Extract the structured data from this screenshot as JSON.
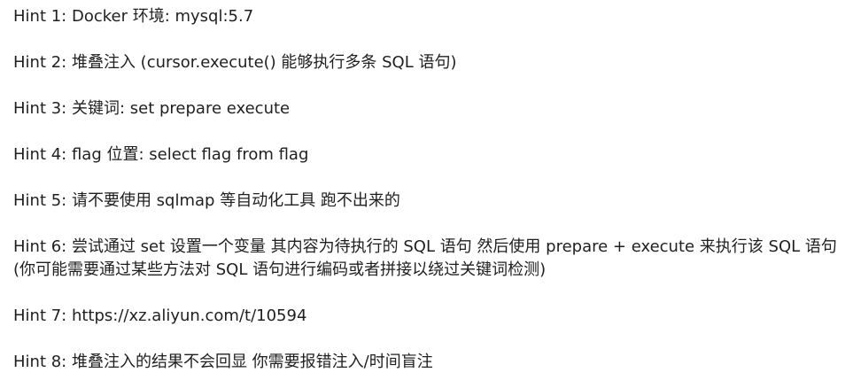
{
  "hints": [
    "Hint 1: Docker 环境: mysql:5.7",
    "Hint 2: 堆叠注入 (cursor.execute() 能够执行多条 SQL 语句)",
    "Hint 3: 关键词: set prepare execute",
    "Hint 4: flag 位置: select flag from flag",
    "Hint 5: 请不要使用 sqlmap 等自动化工具 跑不出来的",
    "Hint 6: 尝试通过 set 设置一个变量 其内容为待执行的 SQL 语句 然后使用 prepare + execute 来执行该 SQL 语句 (你可能需要通过某些方法对 SQL 语句进行编码或者拼接以绕过关键词检测)",
    "Hint 7: https://xz.aliyun.com/t/10594",
    "Hint 8: 堆叠注入的结果不会回显 你需要报错注入/时间盲注"
  ]
}
